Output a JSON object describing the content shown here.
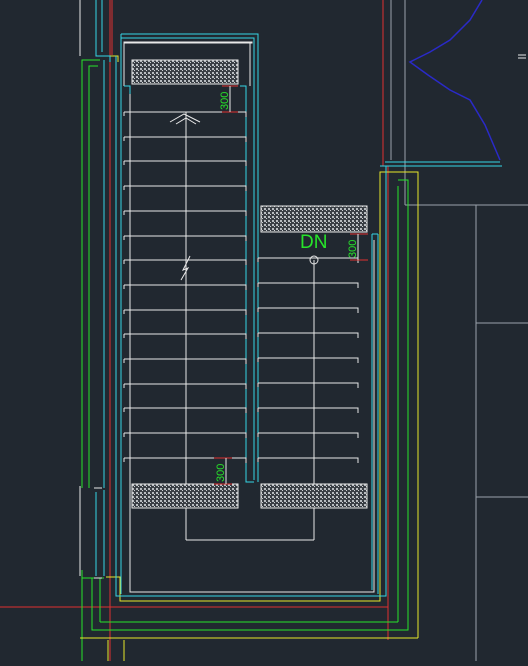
{
  "drawing": {
    "background": "#212830",
    "colors": {
      "cyan": "#35d6e6",
      "white": "#e8e8e8",
      "green": "#27e32a",
      "yellow": "#e8e82a",
      "red": "#e03030",
      "blue": "#2a2ac8",
      "gray": "#9aa2ab"
    },
    "labels": {
      "down_direction": "DN",
      "dim_top_left": "300",
      "dim_right_flight": "300",
      "dim_bottom_left": "300"
    }
  }
}
